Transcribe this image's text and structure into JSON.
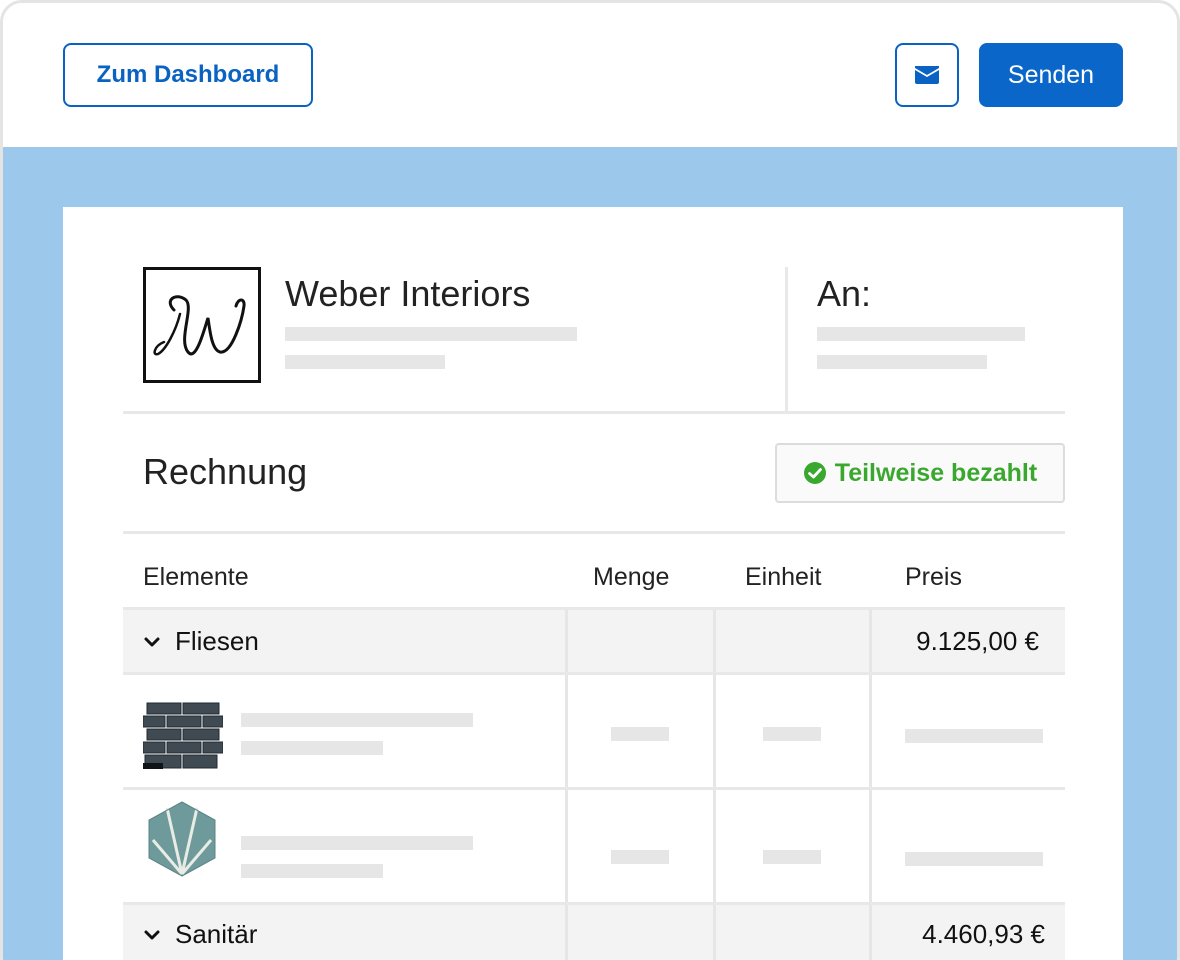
{
  "toolbar": {
    "dashboard_label": "Zum Dashboard",
    "mail_icon": "envelope-icon",
    "send_label": "Senden"
  },
  "colors": {
    "accent": "#0a66c8",
    "canvas_bg": "#9cc8ec",
    "status_green": "#3aa82e",
    "placeholder_gray": "#e6e6e6"
  },
  "invoice": {
    "company_name": "Weber Interiors",
    "logo_icon": "w-monogram-logo",
    "recipient_label": "An:",
    "title": "Rechnung",
    "status": "Teilweise bezahlt",
    "status_icon": "check-circle-icon"
  },
  "table": {
    "headers": [
      "Elemente",
      "Menge",
      "Einheit",
      "Preis"
    ],
    "groups": [
      {
        "label": "Fliesen",
        "price": "9.125,00 €"
      },
      {
        "label": "Sanitär",
        "price": "4.460,93 €"
      }
    ],
    "item_thumbnails": [
      "dark-brick-tile-thumbnail",
      "teal-hexagon-tile-thumbnail"
    ]
  }
}
